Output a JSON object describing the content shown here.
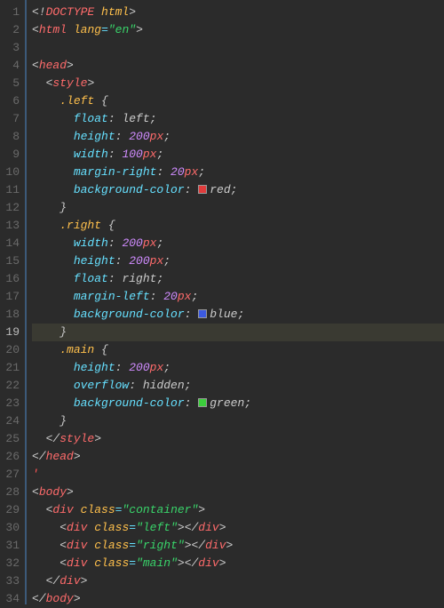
{
  "lineNumbers": [
    "1",
    "2",
    "3",
    "4",
    "5",
    "6",
    "7",
    "8",
    "9",
    "10",
    "11",
    "12",
    "13",
    "14",
    "15",
    "16",
    "17",
    "18",
    "19",
    "20",
    "21",
    "22",
    "23",
    "24",
    "25",
    "26",
    "27",
    "28",
    "29",
    "30",
    "31",
    "32",
    "33",
    "34"
  ],
  "activeLine": 19,
  "code": {
    "l1_doctype": "DOCTYPE",
    "l1_html": "html",
    "l2_tag": "html",
    "l2_attr": "lang",
    "l2_val": "\"en\"",
    "l4_tag": "head",
    "l5_tag": "style",
    "l6_sel": ".left",
    "l7_prop": "float",
    "l7_val": "left",
    "l8_prop": "height",
    "l8_num": "200",
    "l8_unit": "px",
    "l9_prop": "width",
    "l9_num": "100",
    "l9_unit": "px",
    "l10_prop": "margin-right",
    "l10_num": "20",
    "l10_unit": "px",
    "l11_prop": "background-color",
    "l11_val": "red",
    "l13_sel": ".right",
    "l14_prop": "width",
    "l14_num": "200",
    "l14_unit": "px",
    "l15_prop": "height",
    "l15_num": "200",
    "l15_unit": "px",
    "l16_prop": "float",
    "l16_val": "right",
    "l17_prop": "margin-left",
    "l17_num": "20",
    "l17_unit": "px",
    "l18_prop": "background-color",
    "l18_val": "blue",
    "l20_sel": ".main",
    "l21_prop": "height",
    "l21_num": "200",
    "l21_unit": "px",
    "l22_prop": "overflow",
    "l22_val": "hidden",
    "l23_prop": "background-color",
    "l23_val": "green",
    "l25_tag": "style",
    "l26_tag": "head",
    "l27_err": "'",
    "l28_tag": "body",
    "l29_tag": "div",
    "l29_attr": "class",
    "l29_val": "\"container\"",
    "l30a_tag": "div",
    "l30_attr": "class",
    "l30_val": "\"left\"",
    "l30b_tag": "div",
    "l31a_tag": "div",
    "l31_attr": "class",
    "l31_val": "\"right\"",
    "l31b_tag": "div",
    "l32a_tag": "div",
    "l32_attr": "class",
    "l32_val": "\"main\"",
    "l32b_tag": "div",
    "l33_tag": "div",
    "l34_tag": "body"
  }
}
